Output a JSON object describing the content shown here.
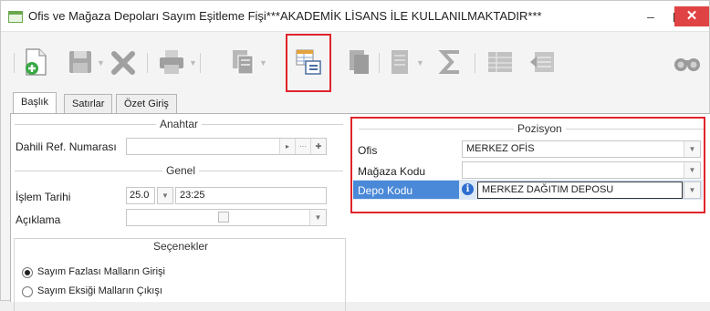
{
  "window": {
    "title": "Ofis ve Mağaza Depoları Sayım Eşitleme Fişi***AKADEMİK LİSANS İLE KULLANILMAKTADIR***",
    "min_glyph": "–",
    "close_glyph": "✕"
  },
  "toolbar": {
    "icons": [
      "new-document-icon",
      "save-icon",
      "delete-icon",
      "print-icon",
      "copy-icon",
      "detail-list-icon",
      "paste-icon",
      "document-icon",
      "sum-icon",
      "grid-icon",
      "export-icon",
      "search-icon"
    ],
    "highlight_color": "#e0242b"
  },
  "tabs": [
    {
      "label": "Başlık",
      "active": true
    },
    {
      "label": "Satırlar",
      "active": false
    },
    {
      "label": "Özet Giriş",
      "active": false
    }
  ],
  "anahtar": {
    "title": "Anahtar",
    "ref_label": "Dahili Ref. Numarası",
    "ref_value": "",
    "btn_next": "▸",
    "btn_more": "···",
    "btn_plus": "✚"
  },
  "genel": {
    "title": "Genel",
    "date_label": "İşlem Tarihi",
    "date_value": "25.0",
    "time_value": "23:25",
    "desc_label": "Açıklama",
    "desc_value": ""
  },
  "secenekler": {
    "title": "Seçenekler",
    "options": [
      {
        "label": "Sayım Fazlası Malların Girişi",
        "checked": true
      },
      {
        "label": "Sayım Eksiği Malların Çıkışı",
        "checked": false
      }
    ]
  },
  "pozisyon": {
    "title": "Pozisyon",
    "ofis_label": "Ofis",
    "ofis_value": "MERKEZ OFİS",
    "magaza_label": "Mağaza Kodu",
    "magaza_value": "",
    "depo_label": "Depo Kodu",
    "depo_value": "MERKEZ DAĞITIM DEPOSU",
    "highlight_color": "#e0242b"
  },
  "dropdown_glyph": "▼",
  "spin_glyph": "▼",
  "info_glyph": "i"
}
